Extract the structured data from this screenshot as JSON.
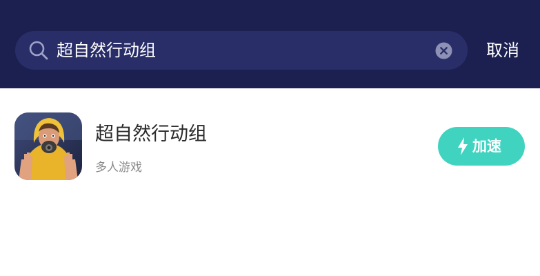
{
  "header": {
    "search_query": "超自然行动组",
    "cancel_label": "取消",
    "search_icon": "search-icon",
    "clear_icon": "clear-icon"
  },
  "results": [
    {
      "title": "超自然行动组",
      "category": "多人游戏",
      "action_label": "加速",
      "action_icon": "lightning-bolt-icon"
    }
  ],
  "colors": {
    "header_bg": "#1c2050",
    "search_bg": "#2a2e68",
    "accent": "#3fd3c0",
    "title_text": "#2a2a2a",
    "secondary_text": "#8a8a8a"
  }
}
